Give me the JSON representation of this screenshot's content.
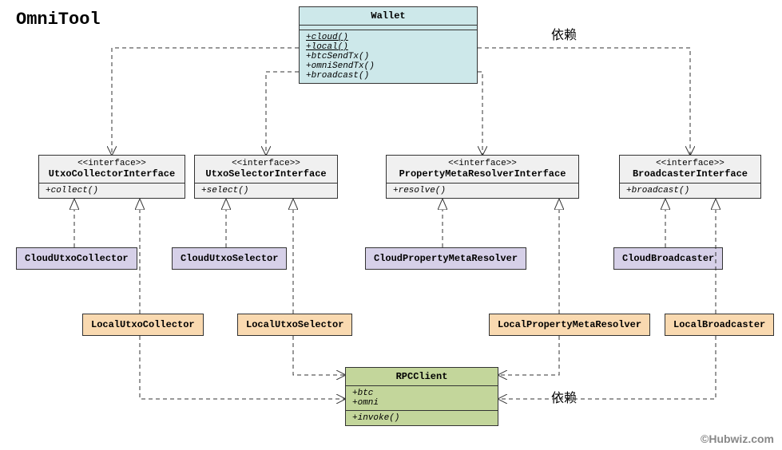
{
  "title": "OmniTool",
  "annotations": {
    "dep1": "依赖",
    "dep2": "依赖"
  },
  "wallet": {
    "name": "Wallet",
    "ops": [
      "+cloud()",
      "+local()",
      "+btcSendTx()",
      "+omniSendTx()",
      "+broadcast()"
    ]
  },
  "rpc": {
    "name": "RPCClient",
    "attrs": [
      "+btc",
      "+omni"
    ],
    "ops": [
      "+invoke()"
    ]
  },
  "interfaces": {
    "collector": {
      "stereo": "<<interface>>",
      "name": "UtxoCollectorInterface",
      "ops": [
        "+collect()"
      ]
    },
    "selector": {
      "stereo": "<<interface>>",
      "name": "UtxoSelectorInterface",
      "ops": [
        "+select()"
      ]
    },
    "resolver": {
      "stereo": "<<interface>>",
      "name": "PropertyMetaResolverInterface",
      "ops": [
        "+resolve()"
      ]
    },
    "broadcaster": {
      "stereo": "<<interface>>",
      "name": "BroadcasterInterface",
      "ops": [
        "+broadcast()"
      ]
    }
  },
  "impls": {
    "cloudCollector": "CloudUtxoCollector",
    "cloudSelector": "CloudUtxoSelector",
    "cloudResolver": "CloudPropertyMetaResolver",
    "cloudBroadcaster": "CloudBroadcaster",
    "localCollector": "LocalUtxoCollector",
    "localSelector": "LocalUtxoSelector",
    "localResolver": "LocalPropertyMetaResolver",
    "localBroadcaster": "LocalBroadcaster"
  },
  "watermark": "©Hubwiz.com"
}
